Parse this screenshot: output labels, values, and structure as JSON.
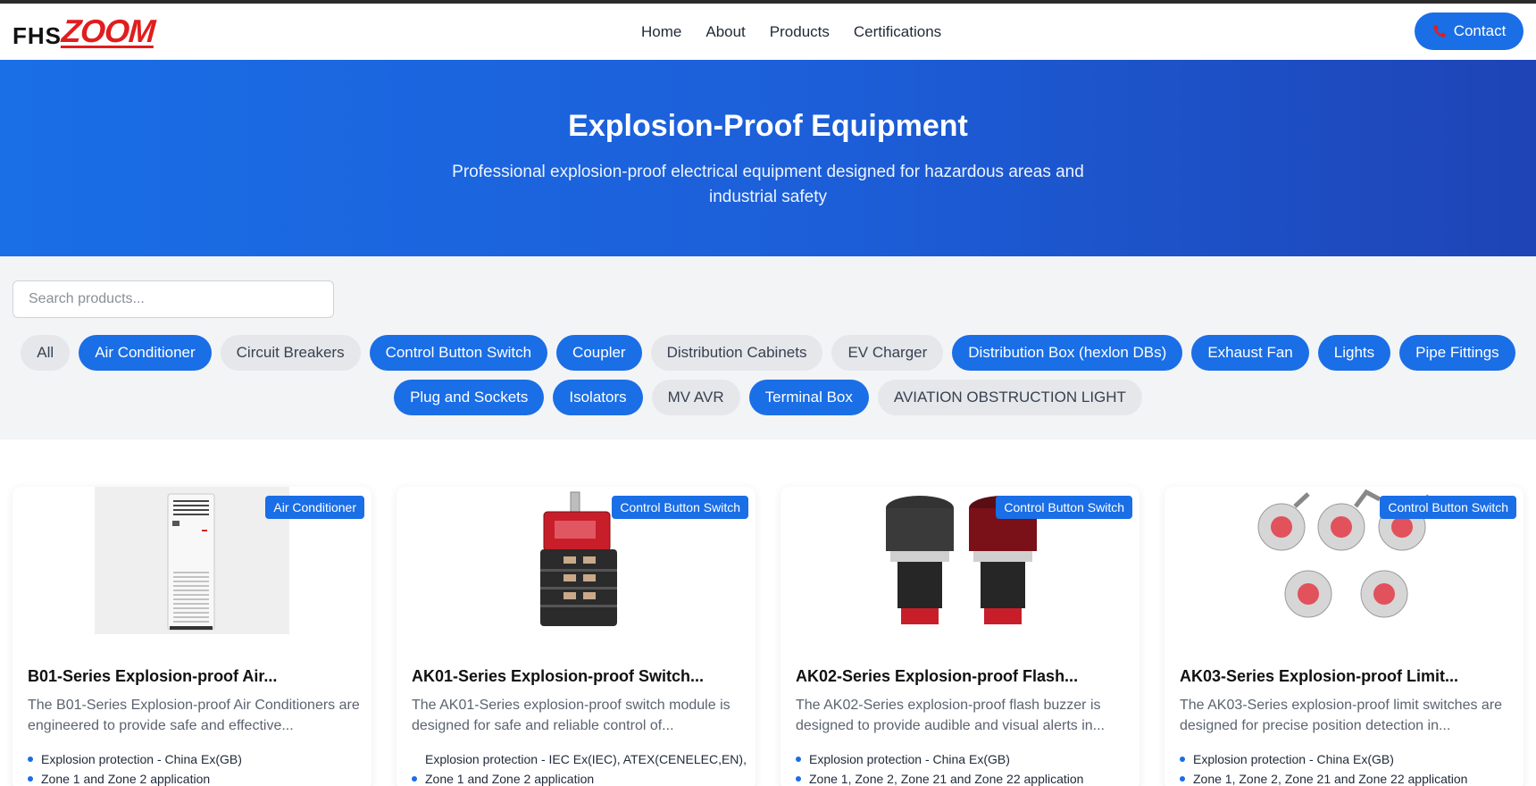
{
  "logo": {
    "part1": "FHS",
    "part2": "ZOOM"
  },
  "nav": {
    "links": [
      "Home",
      "About",
      "Products",
      "Certifications"
    ],
    "contact_label": "Contact",
    "contact_icon": "phone-icon"
  },
  "hero": {
    "title": "Explosion-Proof Equipment",
    "subtitle": "Professional explosion-proof electrical equipment designed for hazardous areas and industrial safety"
  },
  "search": {
    "placeholder": "Search products...",
    "value": ""
  },
  "categories": {
    "row1": [
      {
        "label": "All",
        "style": "gray"
      },
      {
        "label": "Air Conditioner",
        "style": "blue"
      },
      {
        "label": "Circuit Breakers",
        "style": "gray"
      },
      {
        "label": "Control Button Switch",
        "style": "blue"
      },
      {
        "label": "Coupler",
        "style": "blue"
      },
      {
        "label": "Distribution Cabinets",
        "style": "gray"
      },
      {
        "label": "EV Charger",
        "style": "gray"
      },
      {
        "label": "Distribution Box (hexlon DBs)",
        "style": "blue"
      },
      {
        "label": "Exhaust Fan",
        "style": "blue"
      },
      {
        "label": "Lights",
        "style": "blue"
      },
      {
        "label": "Pipe Fittings",
        "style": "blue"
      }
    ],
    "row2": [
      {
        "label": "Plug and Sockets",
        "style": "blue"
      },
      {
        "label": "Isolators",
        "style": "blue"
      },
      {
        "label": "MV AVR",
        "style": "gray"
      },
      {
        "label": "Terminal Box",
        "style": "blue"
      },
      {
        "label": "AVIATION OBSTRUCTION LIGHT",
        "style": "gray"
      }
    ]
  },
  "products": [
    {
      "badge": "Air Conditioner",
      "title": "B01-Series Explosion-proof Air...",
      "description": "The B01-Series Explosion-proof Air Conditioners are engineered to provide safe and effective...",
      "features": [
        "Explosion protection - China Ex(GB)",
        "Zone 1 and Zone 2 application"
      ],
      "image": "air-conditioner-image"
    },
    {
      "badge": "Control Button Switch",
      "title": "AK01-Series Explosion-proof Switch...",
      "description": "The AK01-Series explosion-proof switch module is designed for safe and reliable control of...",
      "features": [
        "Explosion protection - IEC Ex(IEC), ATEX(CENELEC,EN),",
        "Zone 1 and Zone 2 application"
      ],
      "image": "switch-module-image"
    },
    {
      "badge": "Control Button Switch",
      "title": "AK02-Series Explosion-proof Flash...",
      "description": "The AK02-Series explosion-proof flash buzzer is designed to provide audible and visual alerts in...",
      "features": [
        "Explosion protection - China Ex(GB)",
        "Zone 1, Zone 2, Zone 21 and Zone 22 application"
      ],
      "image": "flash-buzzer-image"
    },
    {
      "badge": "Control Button Switch",
      "title": "AK03-Series Explosion-proof Limit...",
      "description": "The AK03-Series explosion-proof limit switches are designed for precise position detection in...",
      "features": [
        "Explosion protection - China Ex(GB)",
        "Zone 1, Zone 2, Zone 21 and Zone 22 application"
      ],
      "image": "limit-switch-image"
    }
  ],
  "colors": {
    "accent": "#1a6ee6",
    "logo_red": "#e11d1d",
    "chip_gray": "#e5e7eb"
  }
}
